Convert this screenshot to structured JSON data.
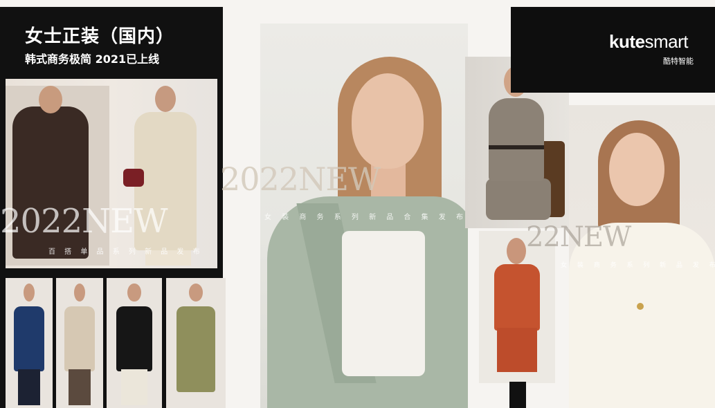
{
  "left_panel": {
    "title_main": "女士正装（国内）",
    "title_sub": "韩式商务极简 2021已上线",
    "overlay_new": "2022NEW",
    "overlay_strip": "百 搭 单 品 系 列 新 品 发 布"
  },
  "center": {
    "overlay_new": "2022NEW",
    "overlay_strip": "女 装 商 务 系 列 新 品 合 集 发 布"
  },
  "right": {
    "brand_bold": "kute",
    "brand_light": "smart",
    "brand_cn": "酷特智能",
    "overlay_new": "22NEW",
    "overlay_strip": "女 装 商 务 系 列 新 品 发 布"
  },
  "colors": {
    "panel_black": "#111111",
    "background": "#f6f4f1"
  }
}
